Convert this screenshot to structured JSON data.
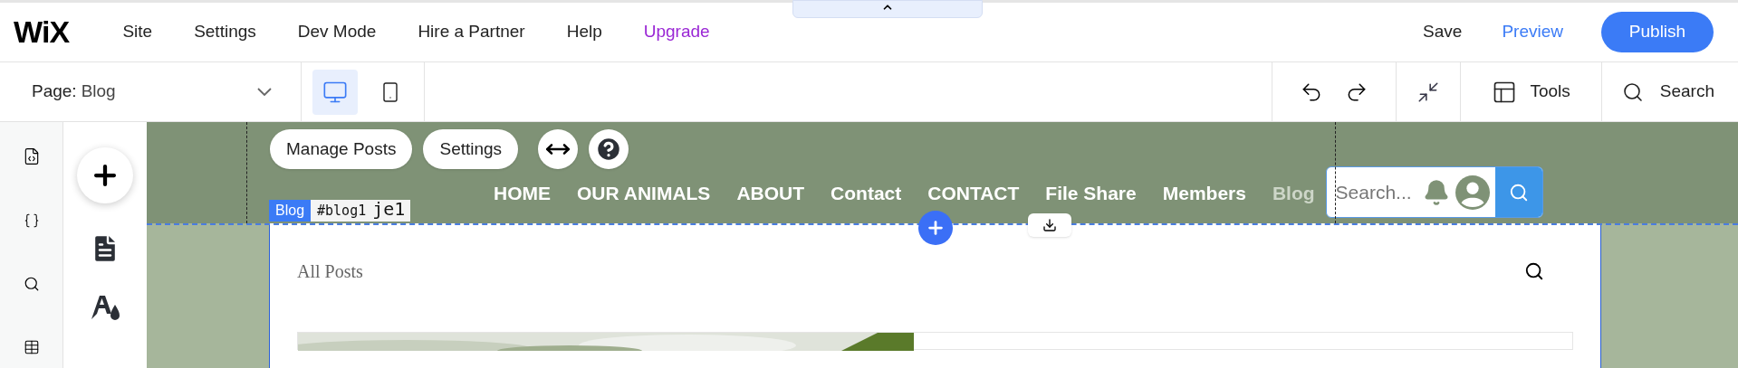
{
  "top_bar": {
    "logo": "WiX",
    "menu": [
      {
        "label": "Site",
        "kind": "normal"
      },
      {
        "label": "Settings",
        "kind": "normal"
      },
      {
        "label": "Dev Mode",
        "kind": "normal"
      },
      {
        "label": "Hire a Partner",
        "kind": "normal"
      },
      {
        "label": "Help",
        "kind": "normal"
      },
      {
        "label": "Upgrade",
        "kind": "upgrade"
      }
    ],
    "save": "Save",
    "preview": "Preview",
    "publish": "Publish"
  },
  "toolbar": {
    "page_prefix": "Page:",
    "page_name": "Blog",
    "devices": [
      {
        "kind": "desktop",
        "selected": true
      },
      {
        "kind": "mobile",
        "selected": false
      }
    ],
    "tools": "Tools",
    "search": "Search"
  },
  "site_nav": [
    {
      "label": "HOME",
      "selected": false
    },
    {
      "label": "OUR ANIMALS",
      "selected": false
    },
    {
      "label": "ABOUT",
      "selected": false
    },
    {
      "label": "Contact",
      "selected": false
    },
    {
      "label": "CONTACT",
      "selected": false
    },
    {
      "label": "File Share",
      "selected": false
    },
    {
      "label": "Members",
      "selected": false
    },
    {
      "label": "Blog",
      "selected": true
    }
  ],
  "site_search": {
    "placeholder": "Search..."
  },
  "floating": {
    "manage_posts": "Manage Posts",
    "settings": "Settings"
  },
  "element_tag": {
    "type": "Blog",
    "id": "#blog1",
    "behind": "je1"
  },
  "blog": {
    "title": "All Posts"
  }
}
